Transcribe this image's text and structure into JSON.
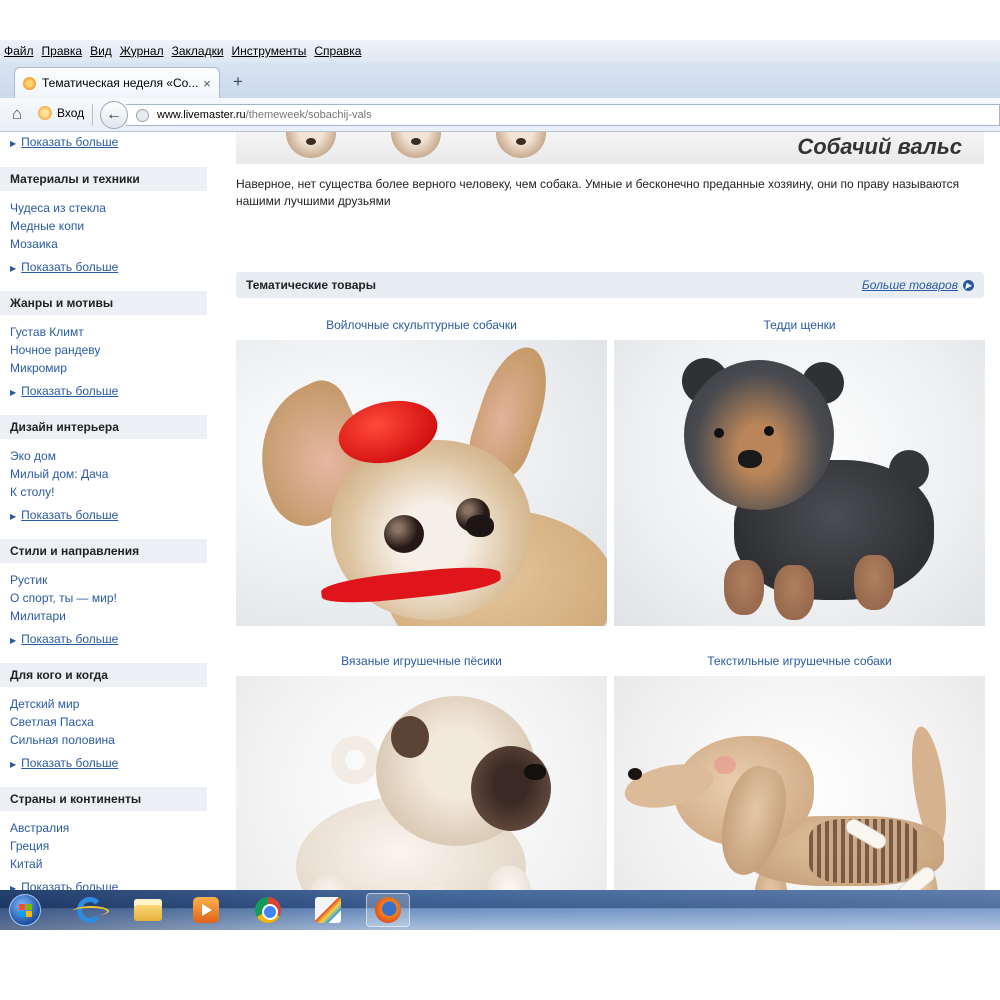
{
  "browser": {
    "menu": [
      "Файл",
      "Правка",
      "Вид",
      "Журнал",
      "Закладки",
      "Инструменты",
      "Справка"
    ],
    "tab_title": "Тематическая неделя «Со...",
    "tab_close": "×",
    "new_tab": "+",
    "login_label": "Вход",
    "url_host": "www.livemaster.ru",
    "url_path": "/themeweek/sobachij-vals"
  },
  "sidebar": {
    "top_more": "Показать больше",
    "categories": [
      {
        "title": "Материалы и техники",
        "links": [
          "Чудеса из стекла",
          "Медные копи",
          "Мозаика"
        ],
        "more": "Показать больше"
      },
      {
        "title": "Жанры и мотивы",
        "links": [
          "Густав Климт",
          "Ночное рандеву",
          "Микромир"
        ],
        "more": "Показать больше"
      },
      {
        "title": "Дизайн интерьера",
        "links": [
          "Эко дом",
          "Милый дом: Дача",
          "К столу!"
        ],
        "more": "Показать больше"
      },
      {
        "title": "Стили и направления",
        "links": [
          "Рустик",
          "О спорт, ты — мир!",
          "Милитари"
        ],
        "more": "Показать больше"
      },
      {
        "title": "Для кого и когда",
        "links": [
          "Детский мир",
          "Светлая Пасха",
          "Сильная половина"
        ],
        "more": "Показать больше"
      },
      {
        "title": "Страны и континенты",
        "links": [
          "Австралия",
          "Греция",
          "Китай"
        ],
        "more": "Показать больше"
      }
    ]
  },
  "main": {
    "banner_title": "Собачий вальс",
    "intro": "Наверное, нет существа более верного человеку, чем собака. Умные и бесконечно преданные хозяину, они по праву называются нашими лучшими друзьями",
    "section_title": "Тематические товары",
    "more_goods": "Больше товаров",
    "products": [
      {
        "caption": "Войлочные скульптурные собачки"
      },
      {
        "caption": "Тедди щенки"
      },
      {
        "caption": "Вязаные игрушечные пёсики"
      },
      {
        "caption": "Текстильные игрушечные собаки"
      }
    ]
  },
  "taskbar": {
    "icons": [
      "windows-start-icon",
      "internet-explorer-icon",
      "folder-icon",
      "media-player-icon",
      "chrome-icon",
      "paint-icon",
      "firefox-icon"
    ]
  }
}
